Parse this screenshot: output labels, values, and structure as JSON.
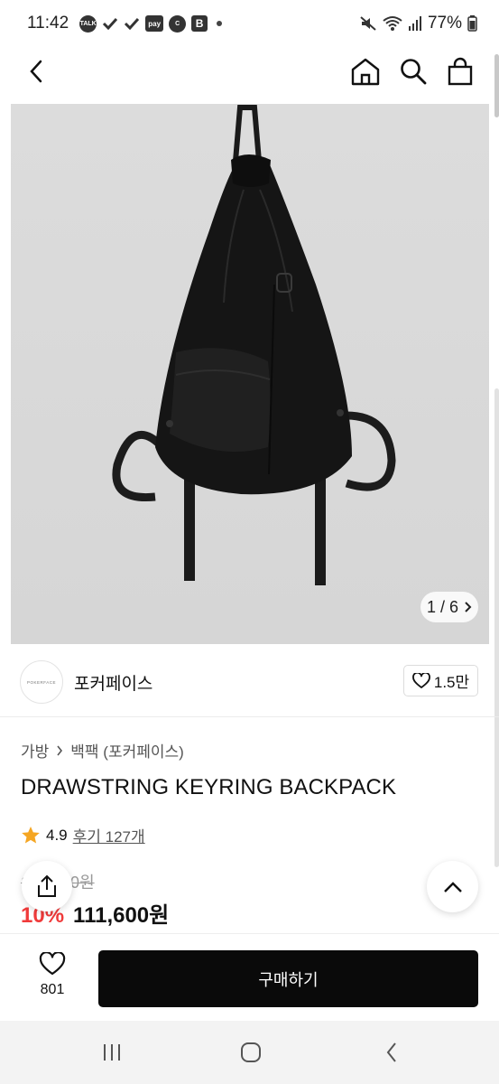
{
  "status_bar": {
    "time": "11:42",
    "talk_badge": "TALK",
    "pay_badge": "pay",
    "c_badge": "C",
    "b_badge": "B",
    "battery": "77%"
  },
  "product": {
    "image_counter": "1 / 6",
    "brand_logo_text": "POKERFACE",
    "brand_name": "포커페이스",
    "like_count": "1.5만",
    "breadcrumb": [
      "가방",
      "백팩 (포커페이스)"
    ],
    "title": "DRAWSTRING KEYRING BACKPACK",
    "rating": "4.9",
    "review_link": "후기 127개",
    "original_price": "124,000원",
    "discount": "10%",
    "price": "111,600원"
  },
  "action_bar": {
    "wish_count": "801",
    "buy_label": "구매하기"
  },
  "colors": {
    "accent_red": "#f03a3a",
    "star": "#f5a623",
    "buy_button": "#0a0a0a"
  }
}
